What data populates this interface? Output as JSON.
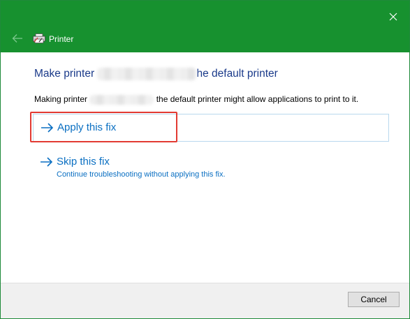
{
  "window": {
    "title": "Printer",
    "accent_color": "#17912f",
    "icons": {
      "close": "close-icon",
      "back": "back-arrow-icon",
      "title": "printer-icon"
    }
  },
  "heading": {
    "prefix": "Make printer",
    "suffix": "he default printer"
  },
  "description": {
    "prefix": "Making printer",
    "suffix": "the default printer might allow applications to print to it."
  },
  "options": {
    "apply": {
      "label": "Apply this fix",
      "icon": "arrow-right-icon"
    },
    "skip": {
      "label": "Skip this fix",
      "sublabel": "Continue troubleshooting without applying this fix.",
      "icon": "arrow-right-icon"
    },
    "link_color": "#0a6fc2",
    "highlight_color": "#e23a32"
  },
  "footer": {
    "cancel_label": "Cancel"
  }
}
